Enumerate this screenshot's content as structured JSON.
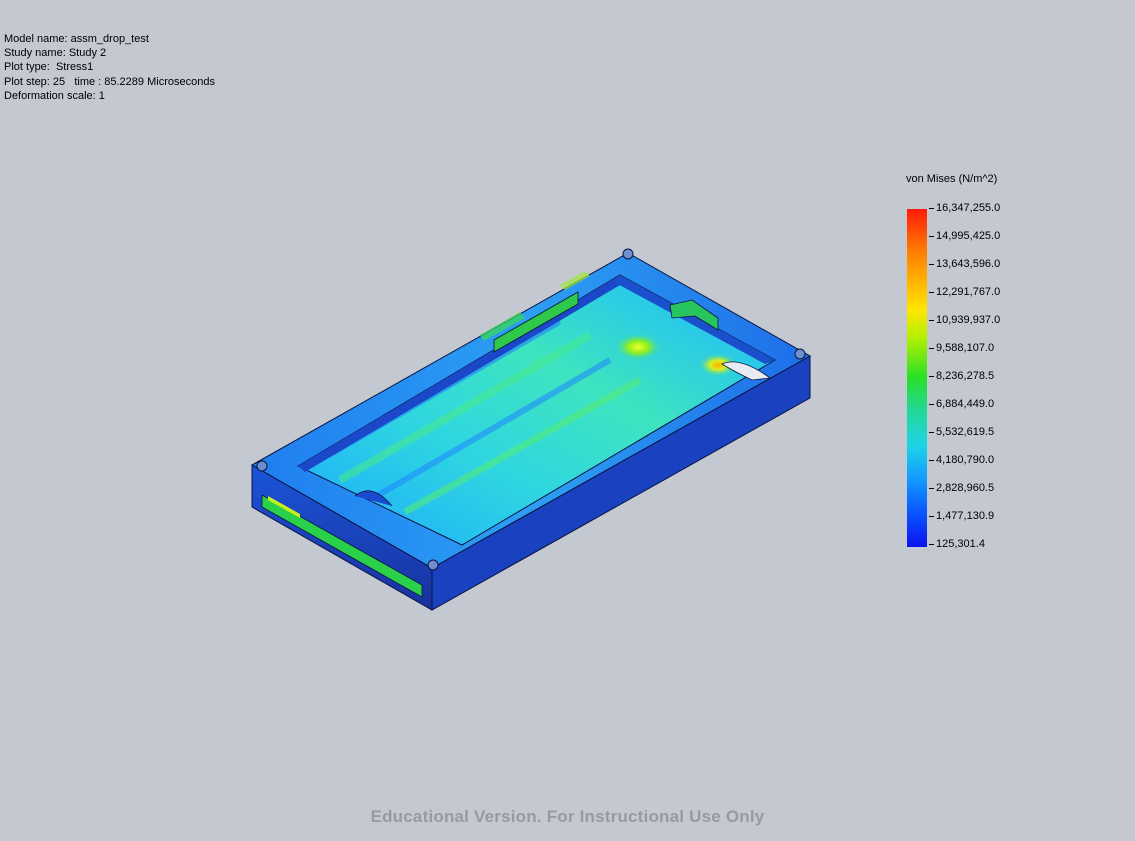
{
  "info": {
    "model_name": "Model name: assm_drop_test",
    "study_name": "Study name: Study 2",
    "plot_type": "Plot type:  Stress1",
    "plot_step": "Plot step: 25   time : 85.2289 Microseconds",
    "deformation_scale": "Deformation scale: 1"
  },
  "legend": {
    "title": "von Mises (N/m^2)",
    "values": [
      "16,347,255.0",
      "14,995,425.0",
      "13,643,596.0",
      "12,291,767.0",
      "10,939,937.0",
      "9,588,107.0",
      "8,236,278.5",
      "6,884,449.0",
      "5,532,619.5",
      "4,180,790.0",
      "2,828,960.5",
      "1,477,130.9",
      "125,301.4"
    ],
    "colors": [
      "#ff1a0a",
      "#ff7a00",
      "#ffe600",
      "#27e02a",
      "#1ed4e6",
      "#129aff",
      "#0b12f0"
    ]
  },
  "watermark": "Educational Version. For Instructional Use Only",
  "background_color": "#c4c8d1"
}
